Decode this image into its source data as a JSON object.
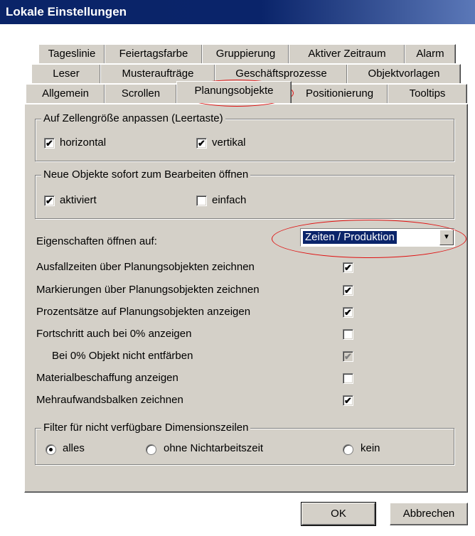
{
  "window": {
    "title": "Lokale Einstellungen"
  },
  "tabs": {
    "row1": [
      "Tageslinie",
      "Feiertagsfarbe",
      "Gruppierung",
      "Aktiver Zeitraum",
      "Alarm"
    ],
    "row2": [
      "Leser",
      "Musteraufträge",
      "Geschäftsprozesse",
      "Objektvorlagen"
    ],
    "row3": [
      "Allgemein",
      "Scrollen",
      "Planungsobjekte",
      "Positionierung",
      "Tooltips"
    ],
    "active": "Planungsobjekte"
  },
  "group_cellsize": {
    "legend": "Auf Zellengröße anpassen (Leertaste)",
    "horizontal": {
      "label": "horizontal",
      "checked": "✔"
    },
    "vertikal": {
      "label": "vertikal",
      "checked": "✔"
    }
  },
  "group_newobjects": {
    "legend": "Neue Objekte sofort zum Bearbeiten öffnen",
    "aktiviert": {
      "label": "aktiviert",
      "checked": "✔"
    },
    "einfach": {
      "label": "einfach",
      "checked": ""
    }
  },
  "properties": {
    "label": "Eigenschaften öffnen auf:",
    "selected": "Zeiten / Produktion"
  },
  "options": [
    {
      "label": "Ausfallzeiten über Planungsobjekten zeichnen",
      "mark": "✔"
    },
    {
      "label": "Markierungen über Planungsobjekten zeichnen",
      "mark": "✔"
    },
    {
      "label": "Prozentsätze auf Planungsobjekten anzeigen",
      "mark": "✔"
    },
    {
      "label": "Fortschritt auch bei 0% anzeigen",
      "mark": ""
    },
    {
      "label": "Bei 0% Objekt nicht entfärben",
      "mark": "✔"
    },
    {
      "label": "Materialbeschaffung anzeigen",
      "mark": ""
    },
    {
      "label": "Mehraufwandsbalken zeichnen",
      "mark": "✔"
    }
  ],
  "filter": {
    "legend": "Filter für nicht verfügbare Dimensionszeilen",
    "alles": "alles",
    "ohne": "ohne Nichtarbeitszeit",
    "kein": "kein",
    "selected": "alles"
  },
  "buttons": {
    "ok": "OK",
    "cancel": "Abbrechen"
  },
  "colors": {
    "titlebar": "#0a246a",
    "face": "#d4d0c8",
    "highlight_oval": "#e01010"
  }
}
